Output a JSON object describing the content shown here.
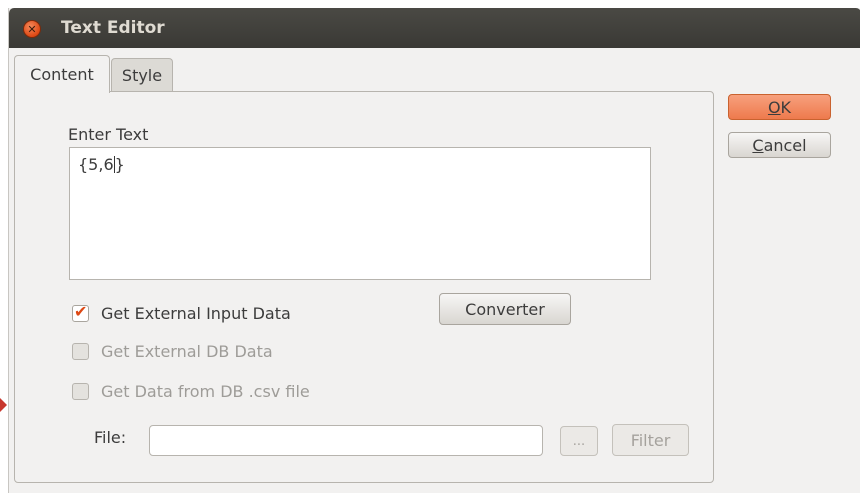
{
  "window": {
    "title": "Text Editor"
  },
  "tabs": [
    {
      "label": "Content",
      "selected": true
    },
    {
      "label": "Style",
      "selected": false
    }
  ],
  "content": {
    "enter_text_label": "Enter Text",
    "text_value_before_caret": "{5,6",
    "text_value_after_caret": "}",
    "converter_label": "Converter",
    "checkboxes": [
      {
        "label": "Get External Input Data",
        "checked": true,
        "enabled": true
      },
      {
        "label": "Get External DB Data",
        "checked": false,
        "enabled": false
      },
      {
        "label": "Get Data from DB .csv file",
        "checked": false,
        "enabled": false
      }
    ],
    "file_label": "File:",
    "file_value": "",
    "browse_label": "...",
    "filter_label": "Filter"
  },
  "buttons": {
    "ok_mnemonic": "O",
    "ok_rest": "K",
    "cancel_mnemonic": "C",
    "cancel_rest": "ancel"
  },
  "colors": {
    "accent": "#dd4814",
    "ok_button": "#ee7a4d",
    "titlebar": "#3c3b37"
  },
  "icons": {
    "close": "close-icon",
    "checkmark": "checkmark-icon"
  }
}
